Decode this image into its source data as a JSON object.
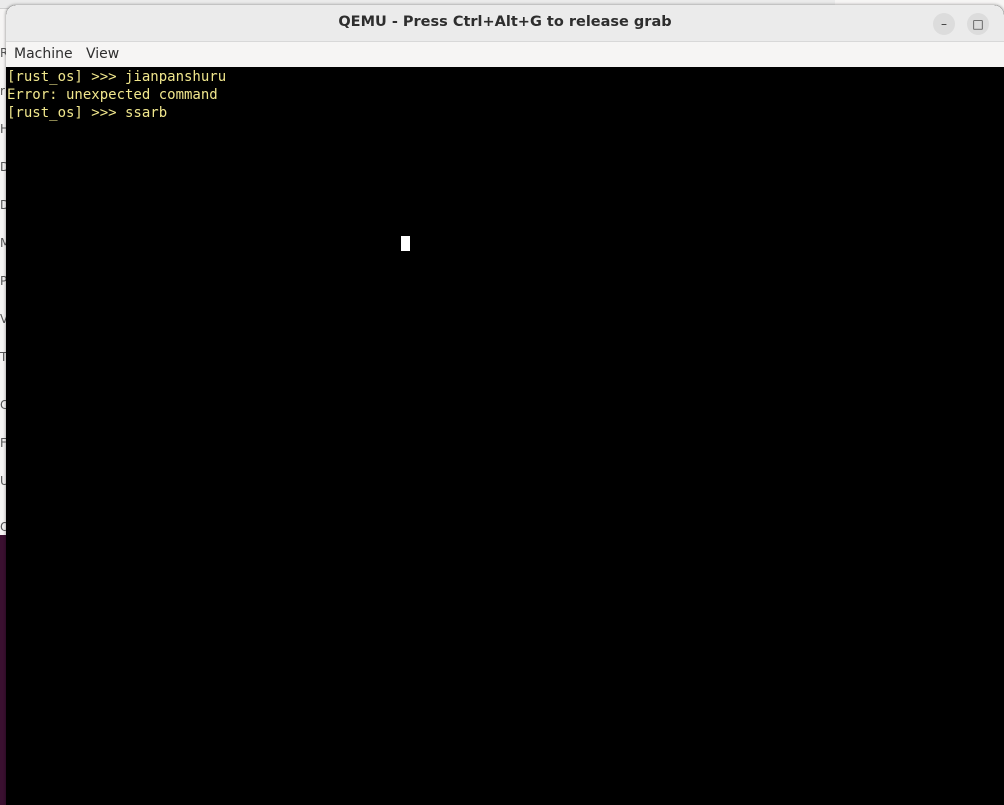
{
  "window": {
    "title": "QEMU - Press Ctrl+Alt+G to release grab",
    "minimize_glyph": "–",
    "maximize_glyph": "□",
    "close_glyph": "×"
  },
  "menu": {
    "items": [
      {
        "label": "Machine"
      },
      {
        "label": "View"
      }
    ]
  },
  "terminal": {
    "text_color": "#f0e68c",
    "background": "#000000",
    "lines": [
      "[rust_os] >>> jianpanshuru",
      "Error: unexpected command",
      "[rust_os] >>> ssarb"
    ]
  },
  "background_window": {
    "edge_letters": [
      "Re",
      "r",
      "H",
      "D",
      "D",
      "M",
      "Pi",
      "V",
      "Tr",
      "C",
      "Fl",
      "U",
      "O"
    ]
  }
}
